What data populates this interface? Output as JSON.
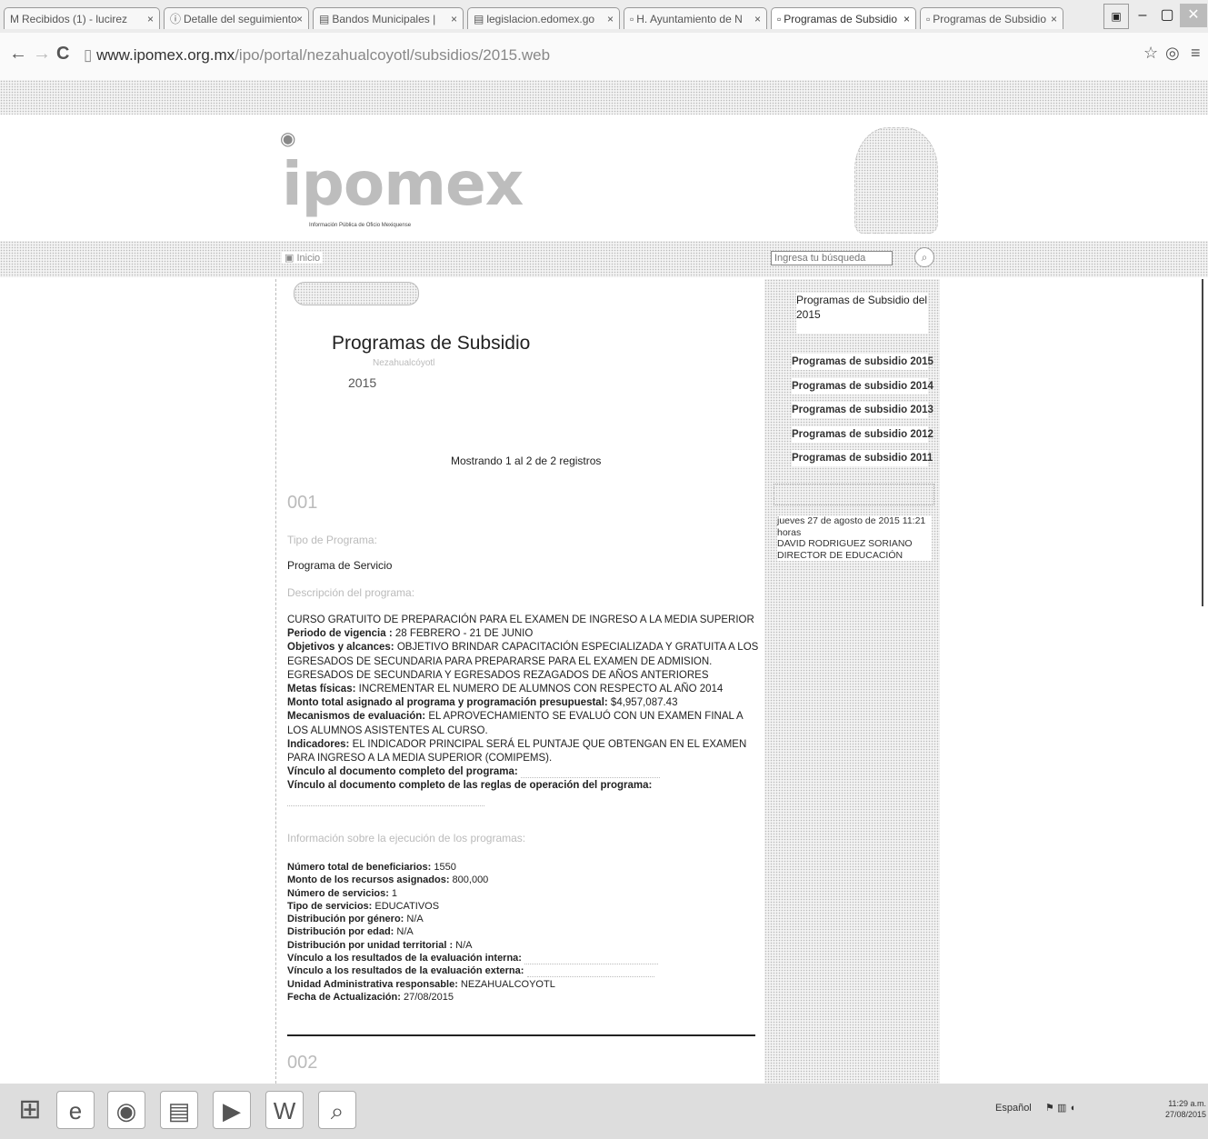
{
  "browser": {
    "tabs": [
      {
        "label": "Recibidos (1) - lucirez",
        "icon": "gmail-icon"
      },
      {
        "label": "Detalle del seguimiento",
        "icon": "info-icon"
      },
      {
        "label": "Bandos Municipales |",
        "icon": "document-icon"
      },
      {
        "label": "legislacion.edomex.go",
        "icon": "document-icon"
      },
      {
        "label": "H. Ayuntamiento de N",
        "icon": "page-icon"
      },
      {
        "label": "Programas de Subsidio",
        "icon": "page-icon"
      },
      {
        "label": "Programas de Subsidio",
        "icon": "page-icon"
      }
    ],
    "url_domain": "www.ipomex.org.mx",
    "url_path": "/ipo/portal/nezahualcoyotl/subsidios/2015.web"
  },
  "header": {
    "logo_text": "ipomex",
    "logo_tagline": "Información Pública de Oficio Mexiquense"
  },
  "nav": {
    "home": "Inicio",
    "search_placeholder": "Ingresa tu búsqueda"
  },
  "main": {
    "title": "Programas de Subsidio",
    "subtitle": "Nezahualcóyotl",
    "year": "2015",
    "records_info": "Mostrando 1 al 2 de 2 registros",
    "record1": {
      "number": "001",
      "type_label": "Tipo de Programa:",
      "type_value": "Programa de Servicio",
      "desc_label": "Descripción del programa:",
      "lines": [
        {
          "label": "",
          "value": "CURSO GRATUITO DE PREPARACIÓN PARA EL EXAMEN DE INGRESO A LA MEDIA SUPERIOR"
        },
        {
          "label": "Periodo de vigencia :",
          "value": " 28 FEBRERO - 21 DE JUNIO"
        },
        {
          "label": "Objetivos y alcances:",
          "value": " OBJETIVO BRINDAR CAPACITACIÓN ESPECIALIZADA Y GRATUITA A LOS EGRESADOS DE SECUNDARIA PARA PREPARARSE PARA EL EXAMEN DE ADMISION. EGRESADOS DE SECUNDARIA Y EGRESADOS REZAGADOS DE AÑOS ANTERIORES"
        },
        {
          "label": "Metas físicas:",
          "value": " INCREMENTAR EL NUMERO DE ALUMNOS CON RESPECTO AL AÑO 2014"
        },
        {
          "label": "Monto total asignado al programa y programación presupuestal:",
          "value": " $4,957,087.43"
        },
        {
          "label": "Mecanismos de evaluación:",
          "value": " EL APROVECHAMIENTO SE EVALUÓ CON UN EXAMEN FINAL A LOS ALUMNOS ASISTENTES AL CURSO."
        },
        {
          "label": "Indicadores:",
          "value": " EL INDICADOR PRINCIPAL SERÁ EL PUNTAJE QUE OBTENGAN EN EL EXAMEN PARA INGRESO A LA MEDIA SUPERIOR (COMIPEMS)."
        }
      ],
      "link1_label": "Vínculo al documento completo del programa:",
      "link2_label": "Vínculo al documento completo de las reglas de operación del programa:",
      "exec_label": "Información sobre la ejecución de los programas:",
      "exec_lines": [
        {
          "label": "Número total de beneficiarios:",
          "value": " 1550"
        },
        {
          "label": "Monto de los recursos asignados:",
          "value": " 800,000"
        },
        {
          "label": "Número de servicios:",
          "value": " 1"
        },
        {
          "label": "Tipo de servicios:",
          "value": " EDUCATIVOS"
        },
        {
          "label": "Distribución por género:",
          "value": " N/A"
        },
        {
          "label": "Distribución por edad:",
          "value": " N/A"
        },
        {
          "label": "Distribución por unidad territorial :",
          "value": " N/A"
        },
        {
          "label": "Vínculo a los resultados de la evaluación interna:",
          "value": ""
        },
        {
          "label": "Vínculo a los resultados de la evaluación externa:",
          "value": ""
        },
        {
          "label": "Unidad Administrativa responsable:",
          "value": " NEZAHUALCOYOTL"
        },
        {
          "label": "Fecha de Actualización:",
          "value": " 27/08/2015"
        }
      ]
    },
    "record2": {
      "number": "002"
    }
  },
  "sidebar": {
    "heading": "Programas de Subsidio del 2015",
    "links": [
      "Programas de subsidio 2015",
      "Programas de subsidio 2014",
      "Programas de subsidio 2013",
      "Programas de subsidio 2012",
      "Programas de subsidio 2011"
    ],
    "update_date": "jueves 27 de agosto de 2015 11:21 horas",
    "responsible_name": "DAVID RODRIGUEZ SORIANO",
    "responsible_role": "DIRECTOR DE EDUCACIÓN"
  },
  "taskbar": {
    "language": "Español",
    "time": "11:29 a.m.",
    "date": "27/08/2015"
  }
}
